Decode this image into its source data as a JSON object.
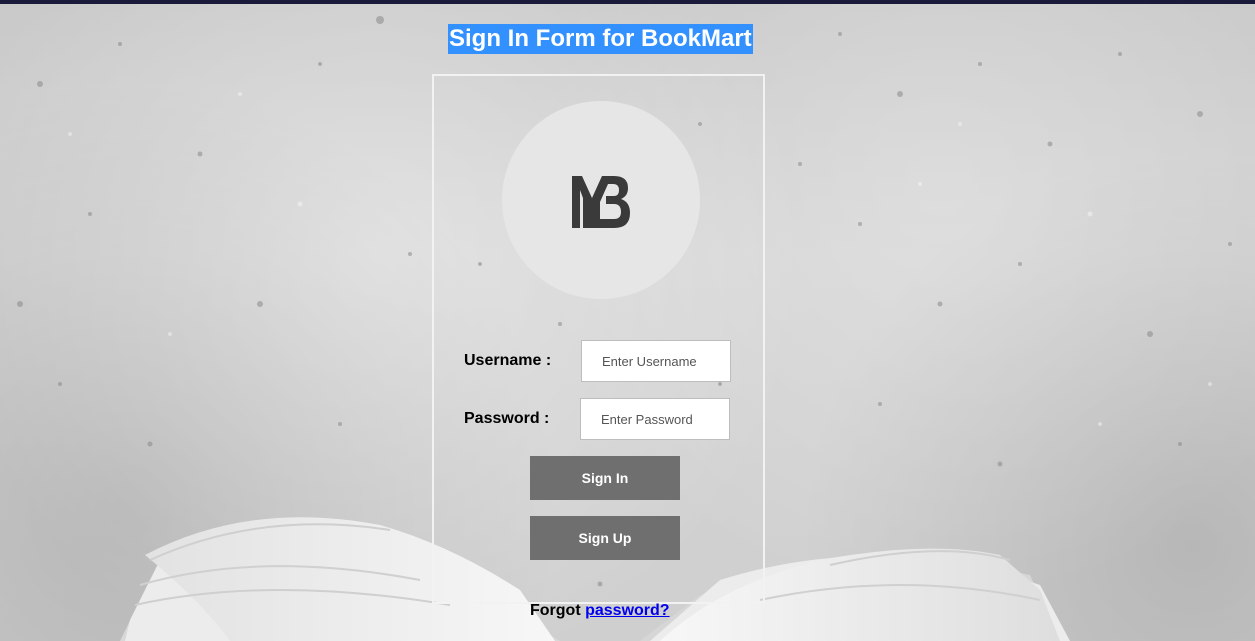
{
  "page": {
    "title": "Sign In Form for BookMart"
  },
  "logo": {
    "icon": "bookmart-mb-logo-icon"
  },
  "form": {
    "username_label": "Username :",
    "username_placeholder": "Enter Username",
    "username_value": "",
    "password_label": "Password :",
    "password_placeholder": "Enter Password",
    "password_value": "",
    "signin_label": "Sign In",
    "signup_label": "Sign Up",
    "forgot_prefix": "Forgot",
    "forgot_link": "password?"
  },
  "colors": {
    "title_highlight": "#3390ff",
    "button_bg": "#6f6f6f",
    "link": "#0000ee",
    "avatar_bg": "#e6e6e6",
    "topbar": "#1a1a3a"
  }
}
